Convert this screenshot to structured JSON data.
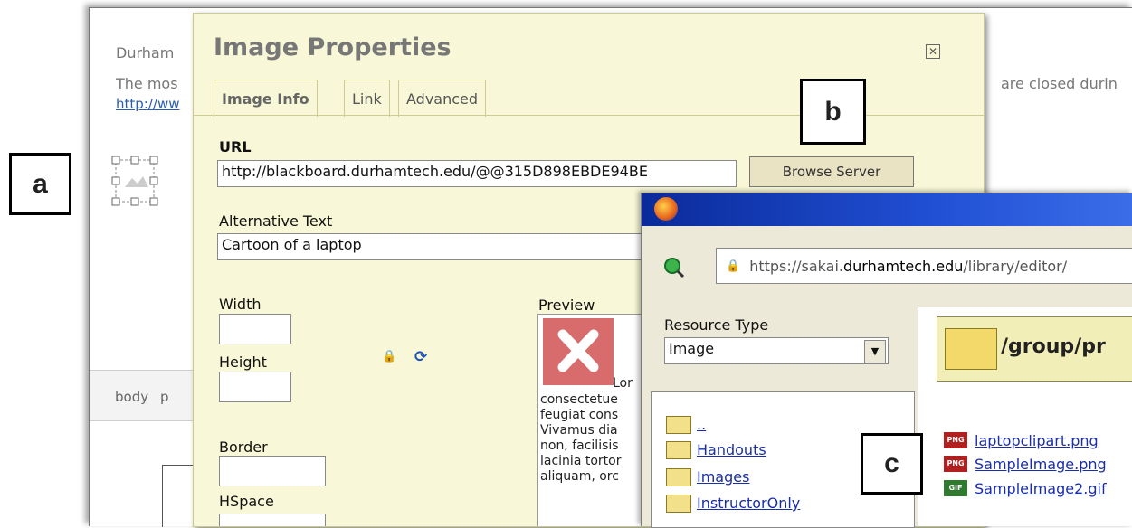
{
  "callouts": {
    "a": "a",
    "b": "b",
    "c": "c"
  },
  "background_editor": {
    "line1": "Durham",
    "line2_prefix": "The mos",
    "line2_suffix": "are closed durin",
    "link": "http://ww",
    "elementbar_items": [
      "body",
      "p"
    ]
  },
  "dialog": {
    "title": "Image Properties",
    "close_icon": "close-icon",
    "tabs": [
      "Image Info",
      "Link",
      "Advanced"
    ],
    "url_label": "URL",
    "url_value": "http://blackboard.durhamtech.edu/@@315D898EBDE94BE",
    "browse_button": "Browse Server",
    "alt_label": "Alternative Text",
    "alt_value": "Cartoon of a laptop",
    "width_label": "Width",
    "height_label": "Height",
    "border_label": "Border",
    "hspace_label": "HSpace",
    "preview_label": "Preview",
    "preview_lines": [
      "Lor",
      "consectetue",
      "feugiat cons",
      "Vivamus dia",
      "non, facilisis",
      "lacinia tortor",
      "aliquam, orc"
    ]
  },
  "browser": {
    "url_prefix": "https://sakai.",
    "url_domain": "durhamtech.edu",
    "url_suffix": "/library/editor/",
    "resource_type_label": "Resource Type",
    "resource_type_value": "Image",
    "folder_path": "/group/pr",
    "tree_items": [
      "..",
      "Handouts",
      "Images",
      "InstructorOnly"
    ],
    "files": [
      {
        "name": "laptopclipart.png",
        "type": "PNG"
      },
      {
        "name": "SampleImage.png",
        "type": "PNG"
      },
      {
        "name": "SampleImage2.gif",
        "type": "GIF"
      }
    ]
  }
}
